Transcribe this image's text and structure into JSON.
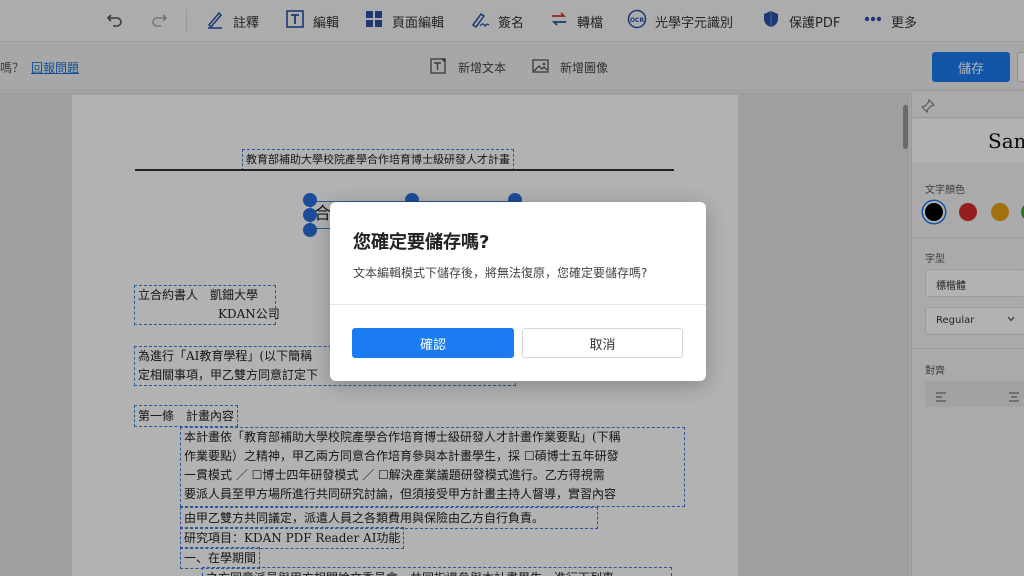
{
  "toolbar": {
    "annotate": "註釋",
    "edit": "編輯",
    "page_edit": "頁面編輯",
    "sign": "簽名",
    "convert": "轉檔",
    "ocr": "光學字元識別",
    "protect": "保護PDF",
    "more": "更多"
  },
  "subbar": {
    "question_fragment": "嗎？",
    "report_link": "回報問題",
    "add_text": "新增文本",
    "add_image": "新增圖像",
    "save_label": "儲存"
  },
  "document": {
    "title": "教育部補助大學校院產學合作培育博士級研發人才計畫",
    "header_fragment": "合",
    "parties_line1": "立合約書人　凱鈿大學",
    "parties_line2": "KDAN公司",
    "purpose_line1": "為進行「AI教育學程」(以下簡稱",
    "purpose_line2": "定相關事項，甲乙雙方同意訂定下",
    "article1": "第一條　計畫內容",
    "body_line1": "本計畫依「教育部補助大學校院產學合作培育博士級研發人才計畫作業要點」(下稱",
    "body_line2": "作業要點）之精神，甲乙兩方同意合作培育參與本計畫學生，採 ☐碩博士五年研發",
    "body_line3": "一貫模式 ／ ☐博士四年研發模式 ／ ☐解決產業議題研發模式進行。乙方得視需",
    "body_line4": "要派人員至甲方場所進行共同研究討論，但須接受甲方計畫主持人督導，實習內容",
    "body_line5": "由甲乙雙方共同議定，派遣人員之各類費用與保險由乙方自行負責。",
    "project_line": "研究項目：KDAN PDF Reader AI功能",
    "semester_line": "一、在學期間",
    "cut_line": "之方同意派員與甲方相關論文委員會，共同指導參與本計畫學生，進行下列事"
  },
  "right_panel": {
    "sample_text": "Sam",
    "text_color_label": "文字顏色",
    "font_label": "字型",
    "font_value": "標楷體",
    "weight_value": "Regular",
    "align_label": "對齊",
    "colors": [
      "#000000",
      "#d92b2b",
      "#e8a317",
      "#3aa24a"
    ]
  },
  "dialog": {
    "title": "您確定要儲存嗎?",
    "message": "文本編輯模式下儲存後，將無法復原，您確定要儲存嗎?",
    "confirm": "確認",
    "cancel": "取消"
  }
}
